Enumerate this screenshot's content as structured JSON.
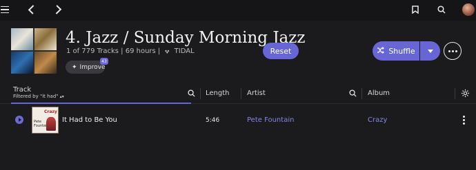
{
  "header": {
    "title": "4. Jazz / Sunday Morning Jazz",
    "meta": "1 of 779 Tracks  |  69 hours  |",
    "source": "TIDAL",
    "improve_label": "Improve",
    "improve_badge": "43",
    "reset_label": "Reset",
    "shuffle_label": "Shuffle"
  },
  "columns": {
    "track": "Track",
    "filter": "Filtered by \"it had\"",
    "length": "Length",
    "artist": "Artist",
    "album": "Album"
  },
  "rows": [
    {
      "title": "It Had to Be You",
      "length": "5:46",
      "artist": "Pete Fountain",
      "album": "Crazy",
      "art_top": "Crazy",
      "art_bottom": "Pete Fountain"
    }
  ],
  "colors": {
    "accent": "#6766d4",
    "background": "#1b1b1d",
    "link": "#8784ea"
  },
  "icons": [
    "menu-icon",
    "back-icon",
    "forward-icon",
    "bookmark-icon",
    "search-icon",
    "avatar",
    "tidal-icon",
    "sparkle-icon",
    "shuffle-icon",
    "chevron-down-icon",
    "more-icon",
    "gear-icon",
    "play-icon"
  ]
}
